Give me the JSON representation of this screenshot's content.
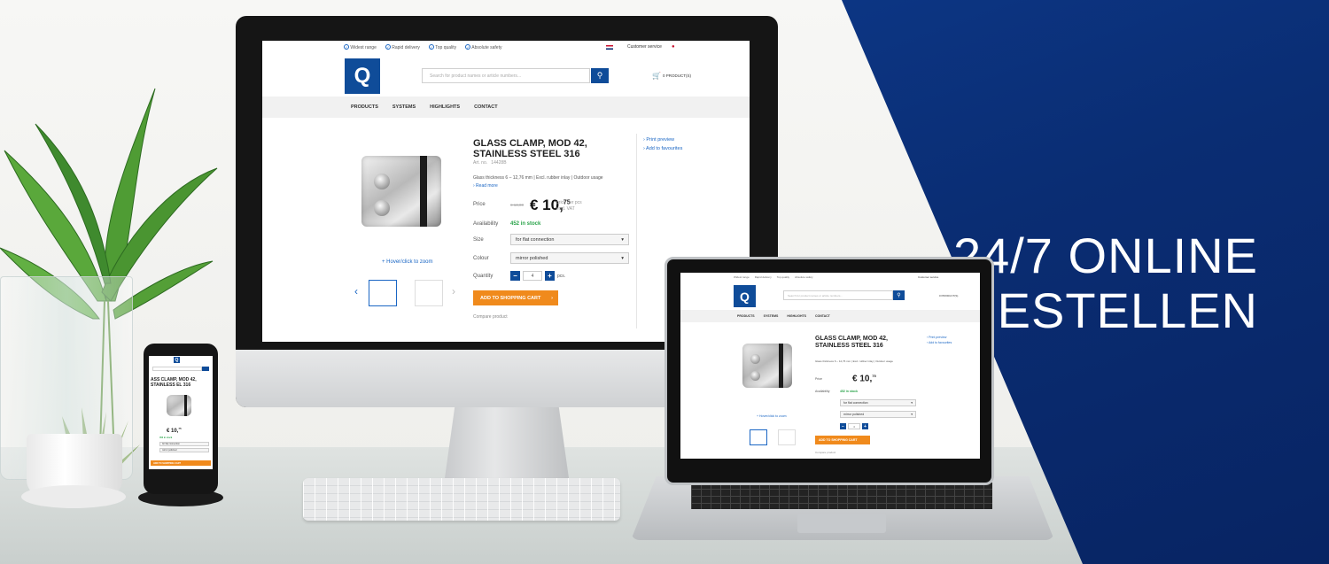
{
  "banner": {
    "line1": "24/7 ONLINE",
    "line2": "BESTELLEN",
    "color": "#0a2d73"
  },
  "site": {
    "usps": [
      "Widest range",
      "Rapid delivery",
      "Top quality",
      "Absolute safety"
    ],
    "customer_service": "Customer service",
    "logo_letter": "Q",
    "search_placeholder": "Search for product names or article numbers...",
    "cart_label": "0 PRODUCT(S)",
    "nav": [
      "PRODUCTS",
      "SYSTEMS",
      "HIGHLIGHTS",
      "CONTACT"
    ],
    "product": {
      "title_line1": "GLASS CLAMP, MOD 42,",
      "title_line2": "STAINLESS STEEL 316",
      "art_label": "Art. no.",
      "art_no": "14428B",
      "description": "Glass thickness 6 – 12,76 mm | Excl. rubber inlay | Outdoor usage",
      "read_more": "› Read more",
      "price_label": "Price",
      "old_price": "€ 13,00",
      "price_main": "€ 10,",
      "price_cents": "75",
      "price_per": "price per pcs",
      "price_vat": "excl. VAT",
      "availability_label": "Availability",
      "stock": "452 in stock",
      "size_label": "Size",
      "size_value": "for flat connection",
      "colour_label": "Colour",
      "colour_value": "mirror polished",
      "quantity_label": "Quantity",
      "quantity_value": "4",
      "quantity_unit": "pcs.",
      "add_to_cart": "ADD TO SHOPPING CART",
      "compare": "Compare product",
      "zoom": "+ Hover/click to zoom",
      "print": "› Print preview",
      "favourites": "› Add to favourites"
    },
    "mobile_title": "ASS CLAMP, MOD 42, STAINLESS EL 316"
  }
}
